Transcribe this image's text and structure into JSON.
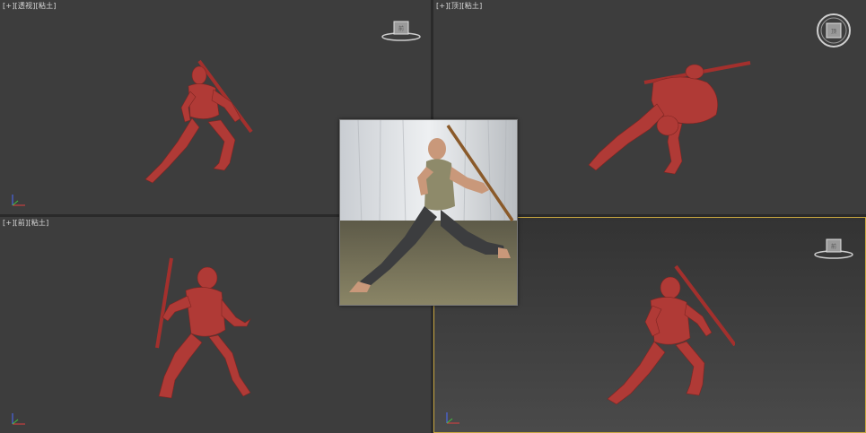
{
  "viewports": {
    "top_left": {
      "label": "[+][透视][粘土]"
    },
    "top_right": {
      "label": "[+][顶][粘土]"
    },
    "bottom_left": {
      "label": "[+][前][粘土]"
    },
    "bottom_right": {
      "label": ""
    }
  },
  "colors": {
    "viewport_bg": "#3d3d3d",
    "active_border": "#c8a640",
    "clay": "#b03a36"
  },
  "icons": {
    "viewcube": "viewcube-icon",
    "axis": "axis-tripod-icon"
  }
}
